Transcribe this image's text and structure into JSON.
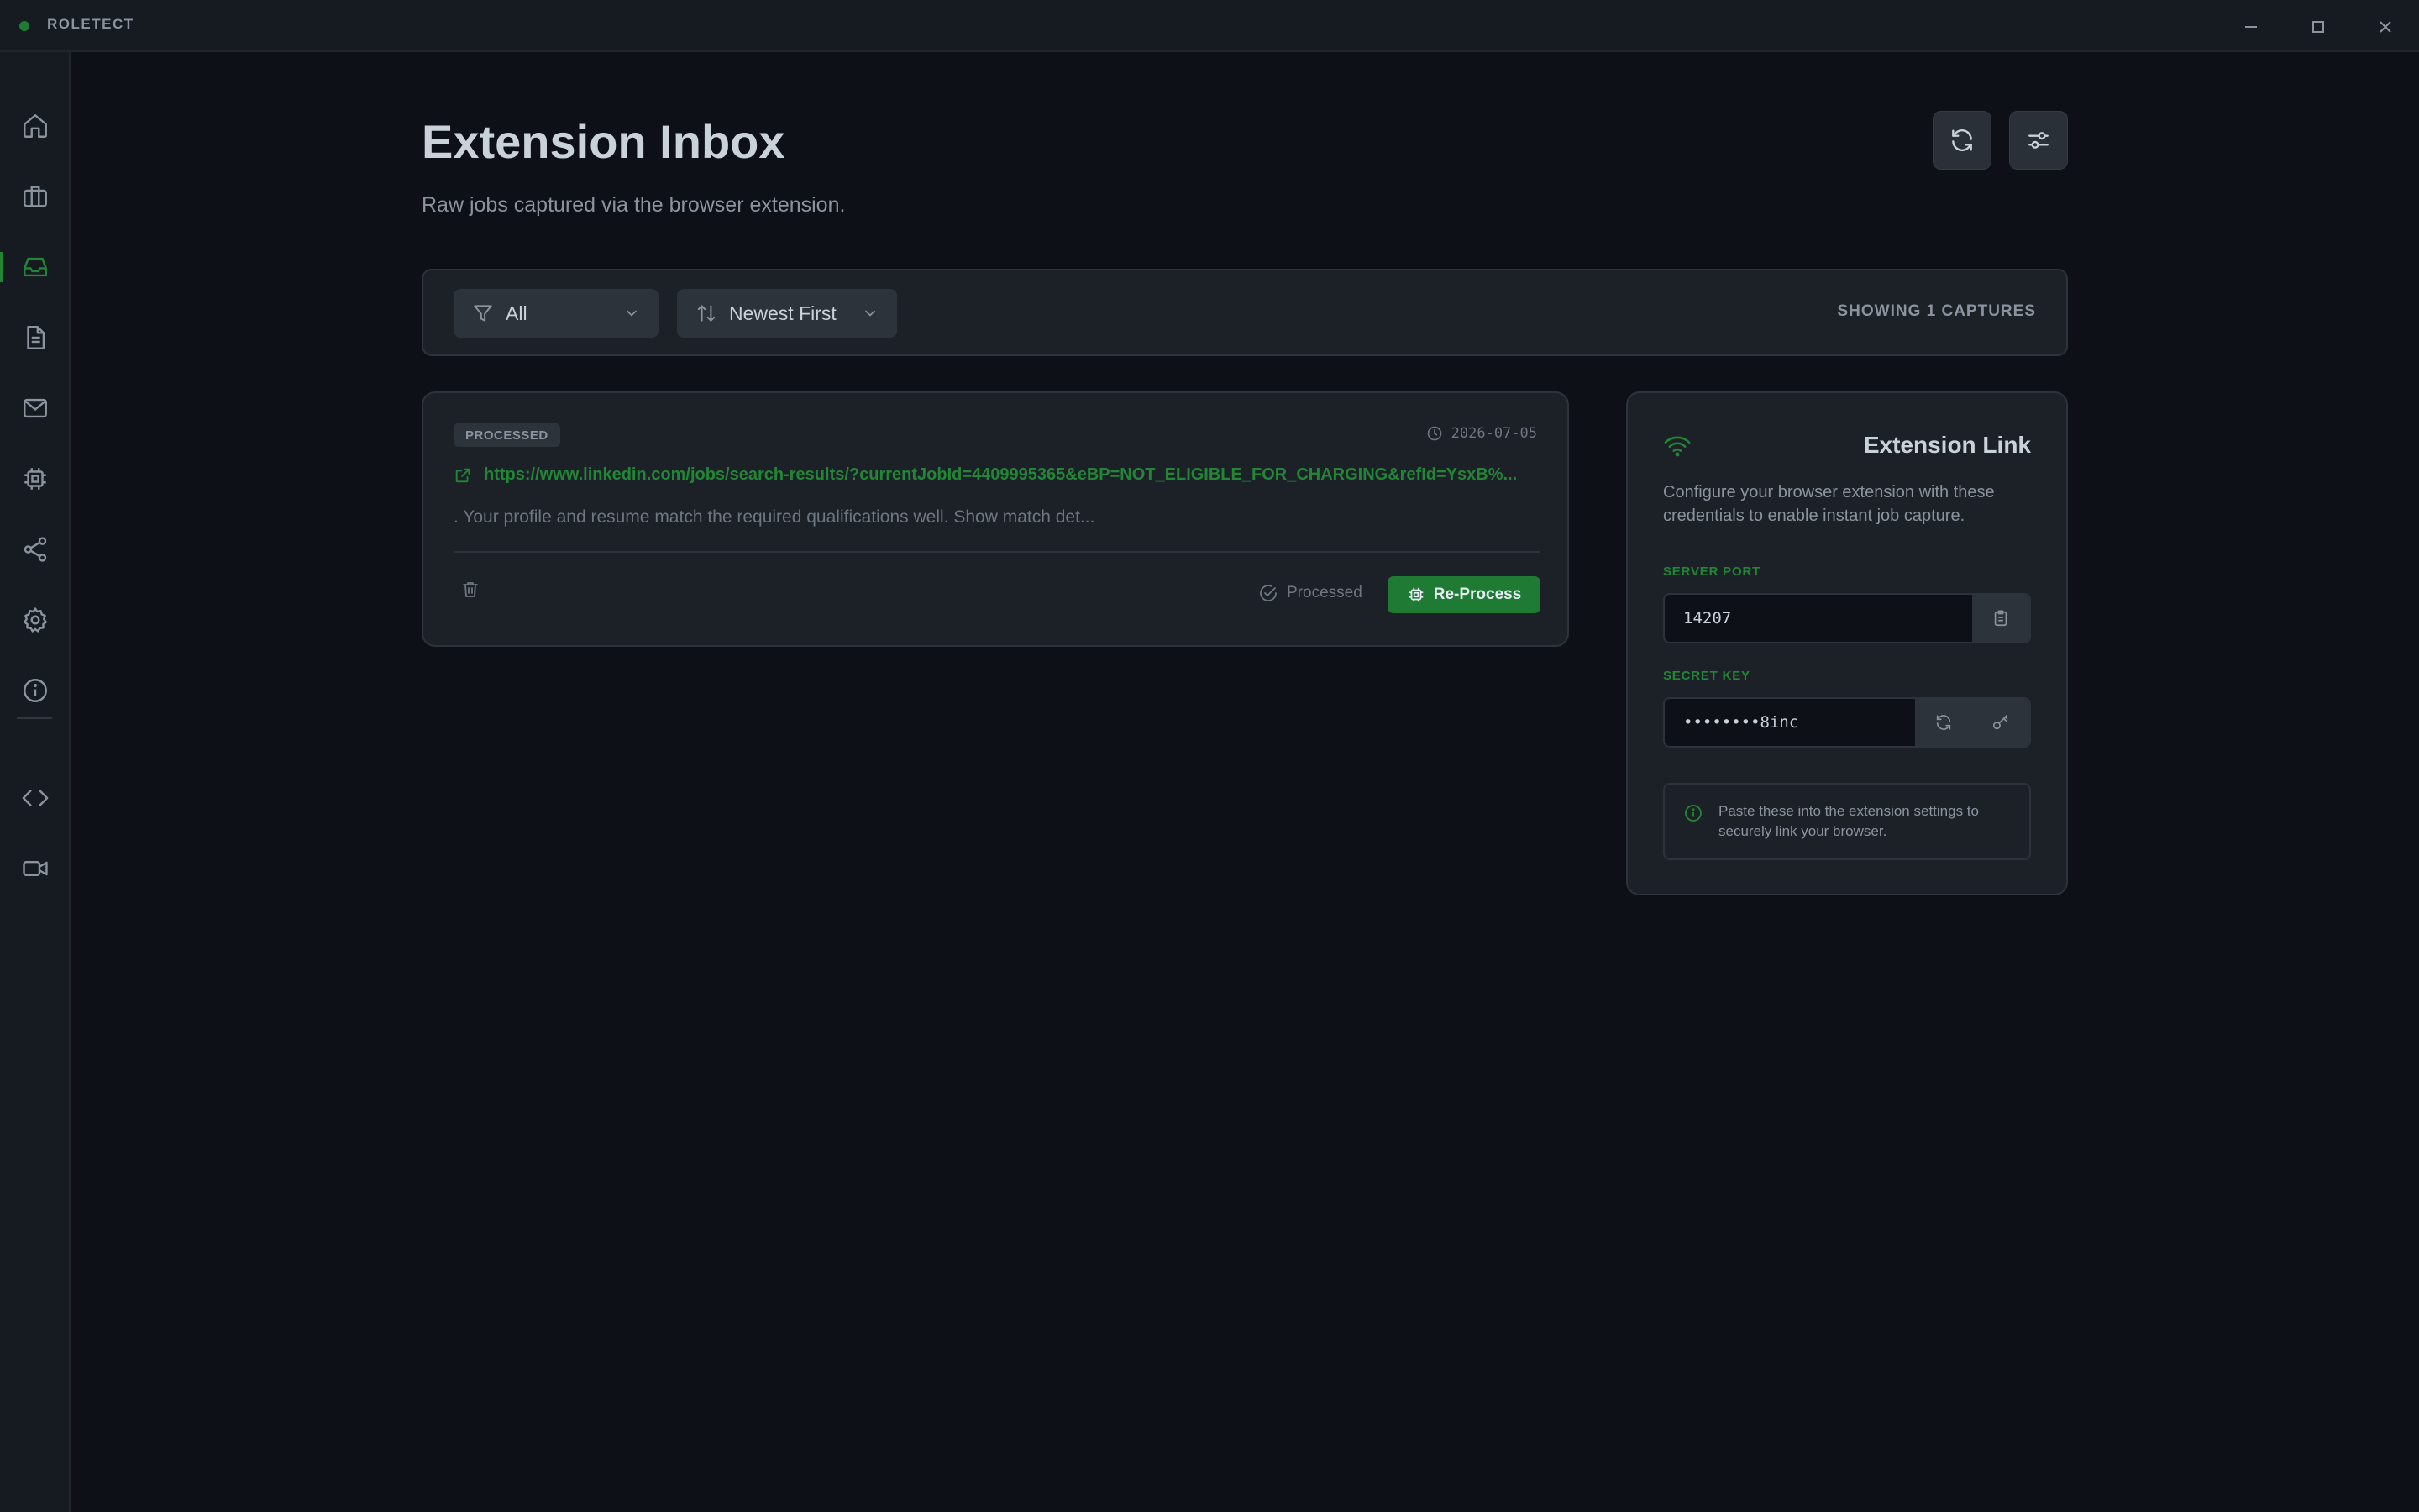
{
  "app": {
    "name": "ROLETECT"
  },
  "window_controls": [
    "minimize-icon",
    "maximize-icon",
    "close-icon"
  ],
  "sidebar": {
    "items": [
      {
        "icon": "home-icon"
      },
      {
        "icon": "briefcase-icon"
      },
      {
        "icon": "inbox-icon",
        "active": true
      },
      {
        "icon": "document-icon"
      },
      {
        "icon": "mail-icon"
      },
      {
        "icon": "chip-icon"
      },
      {
        "icon": "share-icon"
      },
      {
        "icon": "gear-icon"
      },
      {
        "icon": "info-icon"
      },
      {
        "icon": "code-icon"
      },
      {
        "icon": "video-icon"
      }
    ]
  },
  "header": {
    "title": "Extension Inbox",
    "subtitle": "Raw jobs captured via the browser extension.",
    "actions": [
      "refresh-icon",
      "sliders-icon"
    ]
  },
  "filters": {
    "status": {
      "value": "All",
      "icon": "filter-icon"
    },
    "sort": {
      "value": "Newest First",
      "icon": "sort-icon"
    },
    "count_text": "SHOWING 1 CAPTURES"
  },
  "captures": [
    {
      "status_badge": "PROCESSED",
      "date": "2026-07-05",
      "url": "https://www.linkedin.com/jobs/search-results/?currentJobId=4409995365&eBP=NOT_ELIGIBLE_FOR_CHARGING&refId=YsxB%...",
      "description": ". Your profile and resume match the required qualifications well. Show match det...",
      "state_label": "Processed",
      "reprocess_label": "Re-Process"
    }
  ],
  "extension_link": {
    "title": "Extension Link",
    "description": "Configure your browser extension with these credentials to enable instant job capture.",
    "server_port_label": "SERVER PORT",
    "server_port": "14207",
    "secret_key_label": "SECRET KEY",
    "secret_key": "••••••••8inc",
    "note": "Paste these into the extension settings to securely link your browser."
  },
  "colors": {
    "background": "#0d1117",
    "panel": "#1c2128",
    "accent": "#238636",
    "button_green": "#1f7a34"
  }
}
